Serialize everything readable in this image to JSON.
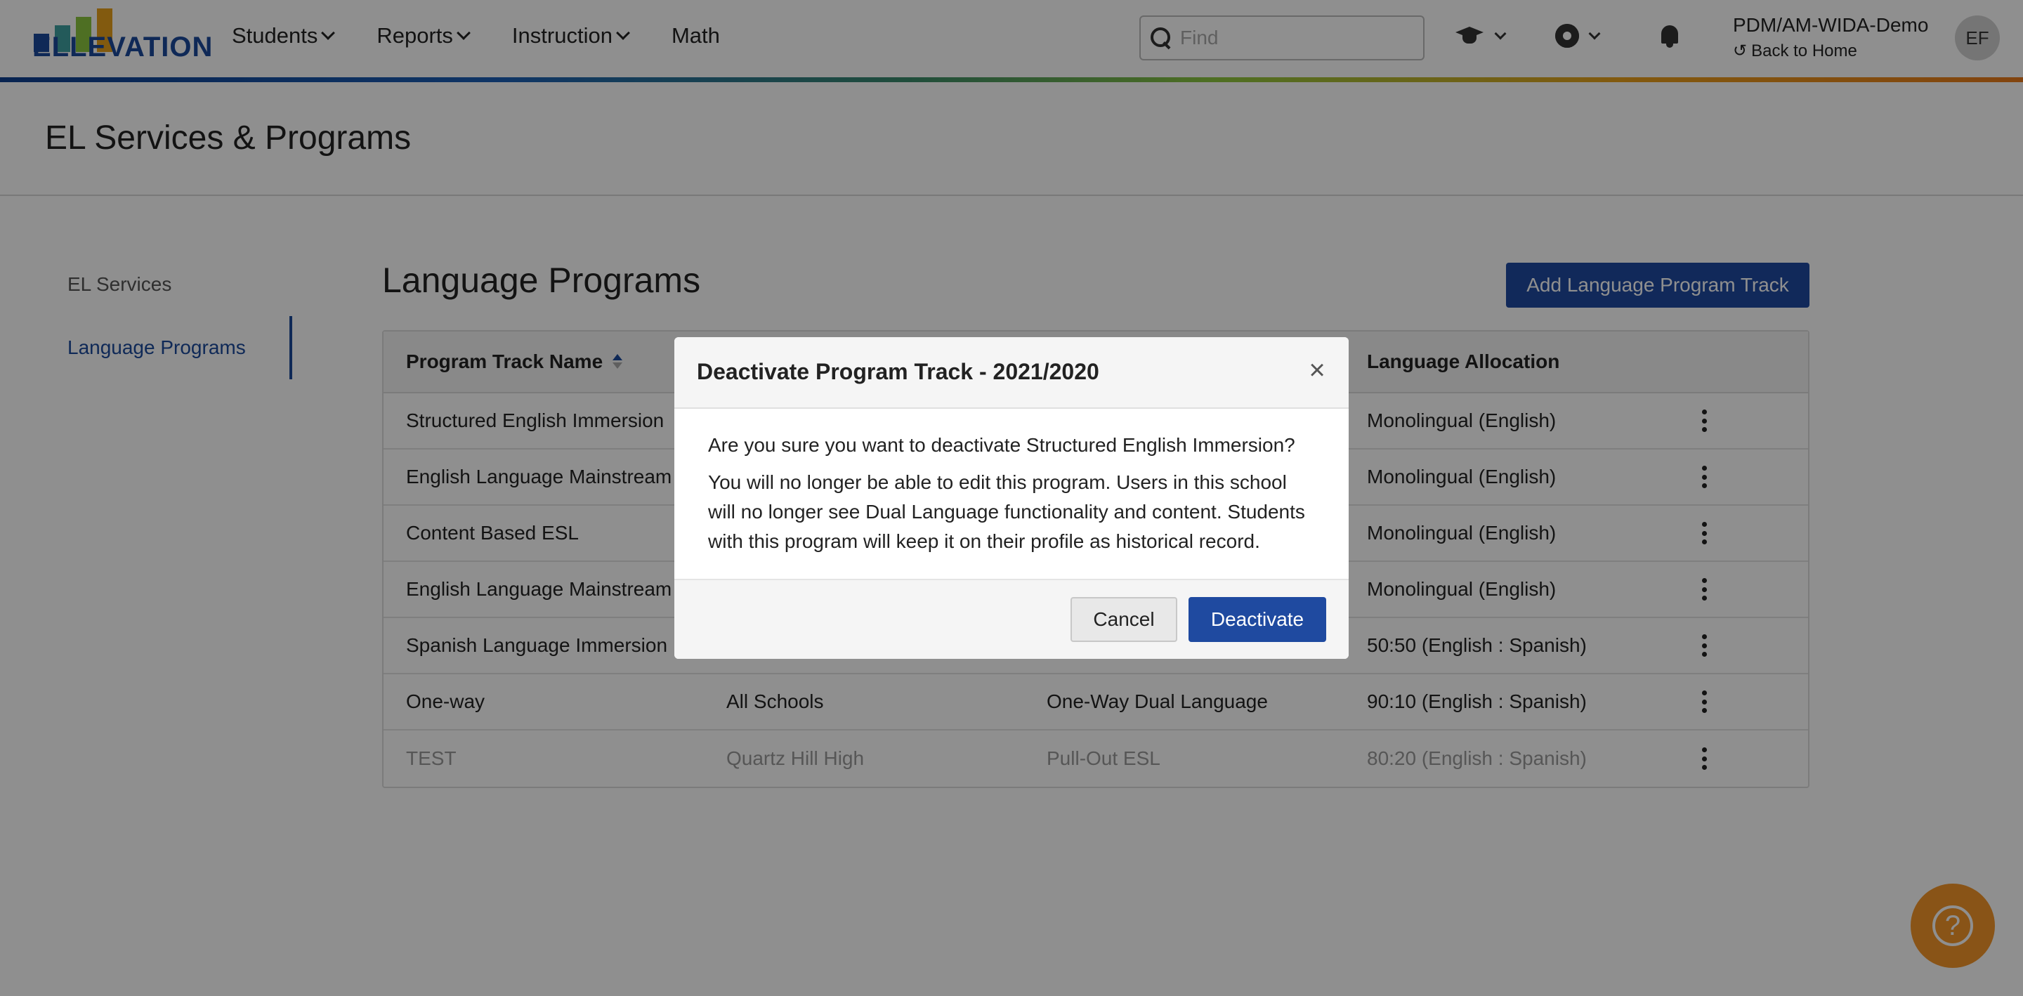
{
  "header": {
    "logo_text": "ELLEVATION",
    "nav": [
      {
        "label": "Students"
      },
      {
        "label": "Reports"
      },
      {
        "label": "Instruction"
      },
      {
        "label": "Math"
      }
    ],
    "search": {
      "placeholder": "Find",
      "value": ""
    },
    "tenant": "PDM/AM-WIDA-Demo",
    "back_home": "Back to Home",
    "avatar_initials": "EF"
  },
  "page": {
    "title": "EL Services & Programs"
  },
  "side_nav": {
    "items": [
      {
        "label": "EL Services"
      },
      {
        "label": "Language Programs"
      }
    ]
  },
  "main": {
    "title": "Language Programs",
    "add_button": "Add Language Program Track",
    "table": {
      "columns": [
        "Program Track Name",
        "",
        "",
        "Language Allocation"
      ],
      "rows": [
        {
          "name": "Structured English Immersion",
          "school": "",
          "model": "",
          "allocation": "Monolingual (English)"
        },
        {
          "name": "English Language Mainstream",
          "school": "",
          "model": "",
          "allocation": "Monolingual (English)"
        },
        {
          "name": "Content Based ESL",
          "school": "",
          "model": "",
          "allocation": "Monolingual (English)"
        },
        {
          "name": "English Language Mainstream",
          "school": "",
          "model": "",
          "allocation": "Monolingual (English)"
        },
        {
          "name": "Spanish Language Immersion",
          "school": "",
          "model": "",
          "allocation": "50:50 (English : Spanish)"
        },
        {
          "name": "One-way",
          "school": "All Schools",
          "model": "One-Way Dual Language",
          "allocation": "90:10 (English : Spanish)"
        },
        {
          "name": "TEST",
          "school": "Quartz Hill High",
          "model": "Pull-Out ESL",
          "allocation": "80:20 (English : Spanish)"
        }
      ]
    }
  },
  "modal": {
    "title": "Deactivate Program Track - 2021/2020",
    "question": "Are you sure you want to deactivate Structured English Immersion?",
    "message": "You will no longer be able to edit this program. Users in this school will no longer see Dual Language functionality and content. Students with this program will keep it on their profile as historical record.",
    "cancel_label": "Cancel",
    "confirm_label": "Deactivate"
  },
  "help": {
    "label": "?"
  },
  "colors": {
    "brand_blue": "#1f4aa0",
    "help_orange": "#f5962a",
    "overlay": "rgba(0,0,0,0.44)"
  }
}
